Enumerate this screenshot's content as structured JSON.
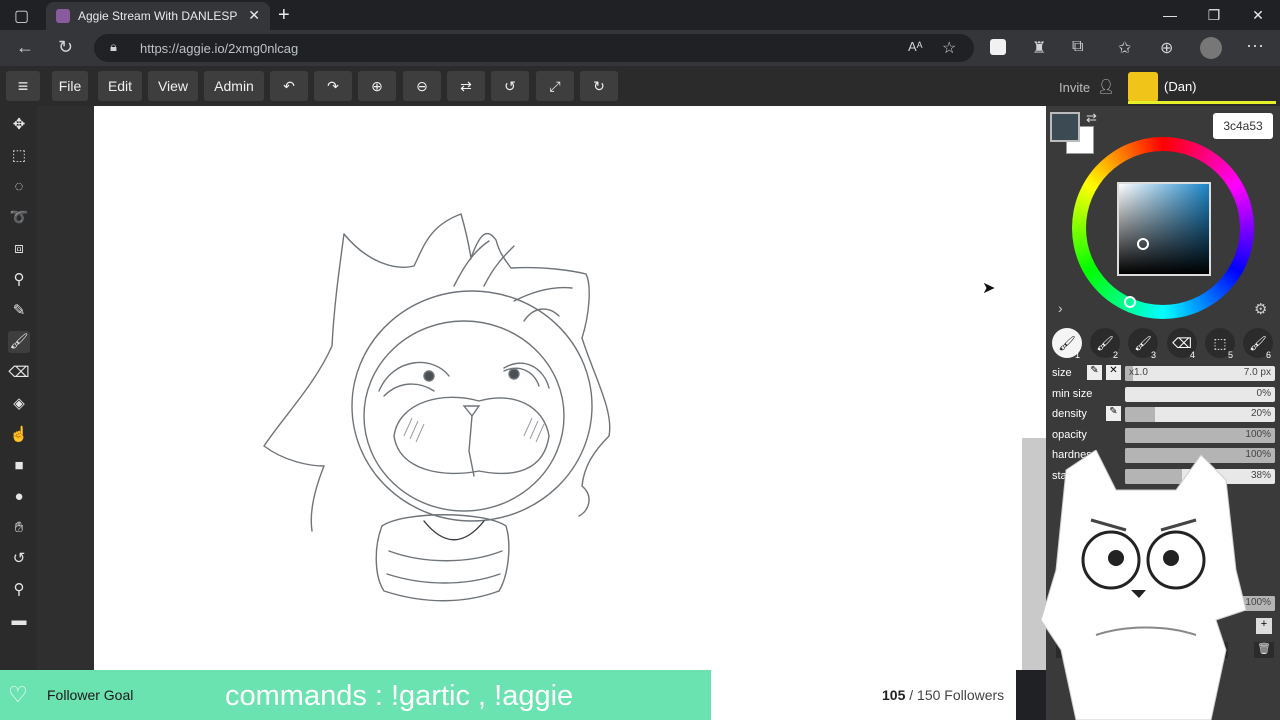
{
  "browser": {
    "tab_title": "Aggie Stream With DANLESPOIR",
    "close_glyph": "✕",
    "new_tab_glyph": "+",
    "url": "https://aggie.io/2xmg0nlcag",
    "window": {
      "minimize": "—",
      "maximize": "❐",
      "close": "✕"
    }
  },
  "app": {
    "menu": [
      "File",
      "Edit",
      "View",
      "Admin"
    ],
    "toolbar_icons": [
      "undo-icon",
      "redo-icon",
      "zoom-in-icon",
      "zoom-out-icon",
      "flip-icon",
      "rotate-left-icon",
      "fullscreen-icon",
      "rotate-right-icon"
    ],
    "invite_label": "Invite",
    "user_name": "(Dan)",
    "left_tools": [
      "move-icon",
      "rect-select-icon",
      "ellipse-select-icon",
      "lasso-icon",
      "transform-icon",
      "eyedropper-icon",
      "pencil-icon",
      "brush-icon",
      "eraser-icon",
      "fill-icon",
      "smudge-icon",
      "rectangle-icon",
      "circle-icon",
      "hand-icon",
      "rotate-icon",
      "zoom-icon",
      "comment-icon"
    ]
  },
  "color_panel": {
    "hex": "3c4a53",
    "foreground": "#3c4a53",
    "background": "#ffffff"
  },
  "brushes": [
    {
      "number": "1",
      "active": true
    },
    {
      "number": "2",
      "active": false
    },
    {
      "number": "3",
      "active": false
    },
    {
      "number": "4",
      "active": false
    },
    {
      "number": "5",
      "active": false
    },
    {
      "number": "6",
      "active": false
    }
  ],
  "brush_settings": [
    {
      "label": "size",
      "value": "7.0 px",
      "extra": "x1.0",
      "fraction": 0.05
    },
    {
      "label": "min size",
      "value": "0%",
      "fraction": 0.0
    },
    {
      "label": "density",
      "value": "20%",
      "fraction": 0.2
    },
    {
      "label": "opacity",
      "value": "100%",
      "fraction": 1.0
    },
    {
      "label": "hardness",
      "value": "100%",
      "fraction": 1.0
    },
    {
      "label": "stabi",
      "value": "38%",
      "fraction": 0.38
    }
  ],
  "layers": {
    "opacity_value": "100%"
  },
  "overlay": {
    "goal_label": "Follower Goal",
    "commands": "commands : !gartic , !aggie",
    "followers_current": "105",
    "followers_rest": " / 150 Followers"
  }
}
